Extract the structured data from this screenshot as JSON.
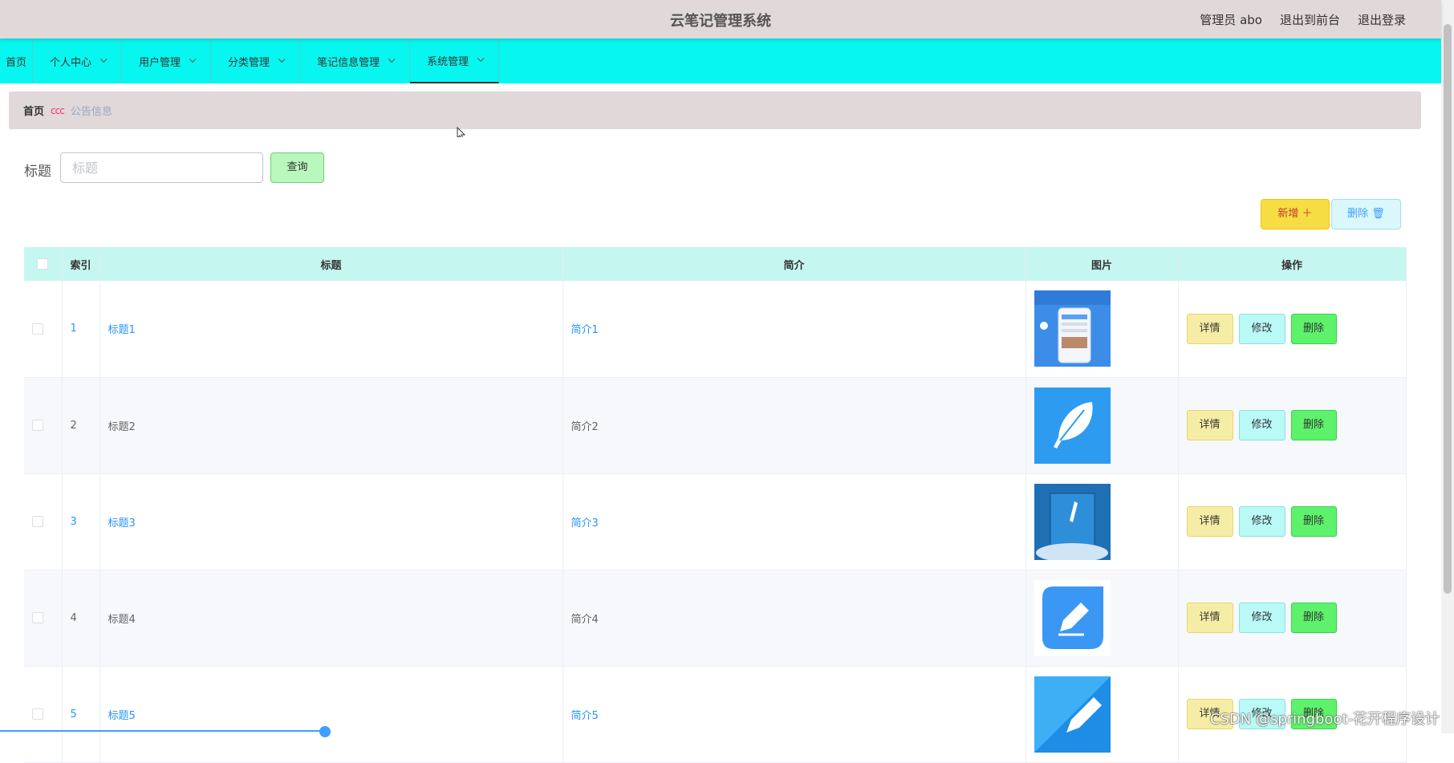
{
  "header": {
    "title": "云笔记管理系统",
    "user": "管理员 abo",
    "front_link": "退出到前台",
    "logout_link": "退出登录"
  },
  "nav": {
    "items": [
      {
        "label": "首页",
        "dropdown": false
      },
      {
        "label": "个人中心",
        "dropdown": true
      },
      {
        "label": "用户管理",
        "dropdown": true
      },
      {
        "label": "分类管理",
        "dropdown": true
      },
      {
        "label": "笔记信息管理",
        "dropdown": true
      },
      {
        "label": "系统管理",
        "dropdown": true,
        "active": true
      }
    ]
  },
  "breadcrumb": {
    "home": "首页",
    "separator": "ccc",
    "current": "公告信息"
  },
  "search": {
    "label": "标题",
    "placeholder": "标题",
    "value": "",
    "button": "查询"
  },
  "actions": {
    "add": "新增 ＋",
    "delete": "删除 🗑"
  },
  "table": {
    "headers": [
      "索引",
      "标题",
      "简介",
      "图片",
      "操作"
    ],
    "rows": [
      {
        "index": "1",
        "title": "标题1",
        "intro": "简介1",
        "image_icon": "phone-app-screenshot",
        "link_color": "blue"
      },
      {
        "index": "2",
        "title": "标题2",
        "intro": "简介2",
        "image_icon": "feather-icon",
        "link_color": "gray"
      },
      {
        "index": "3",
        "title": "标题3",
        "intro": "简介3",
        "image_icon": "notebook-cover",
        "link_color": "blue"
      },
      {
        "index": "4",
        "title": "标题4",
        "intro": "简介4",
        "image_icon": "edit-pencil-icon",
        "link_color": "gray"
      },
      {
        "index": "5",
        "title": "标题5",
        "intro": "简介5",
        "image_icon": "pencil-app-icon",
        "link_color": "blue"
      }
    ],
    "row_actions": {
      "detail": "详情",
      "edit": "修改",
      "remove": "删除"
    }
  },
  "watermark": "CSDN @springboot-花开程序设计",
  "colors": {
    "topbar": "#e0d8d9",
    "navbar": "#07f6ef",
    "table_header": "#c6f6f0",
    "link": "#2893ff"
  }
}
